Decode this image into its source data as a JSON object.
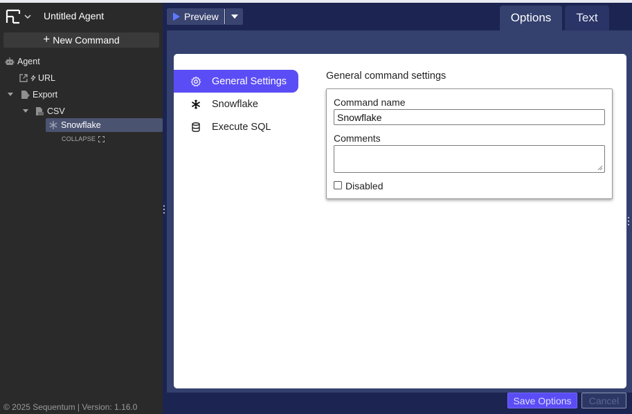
{
  "app": {
    "agent_title": "Untitled Agent",
    "new_command_label": "New Command",
    "footer": "© 2025 Sequentum | Version: 1.16.0"
  },
  "tree": {
    "items": [
      {
        "label": "Agent",
        "icon": "robot-icon"
      },
      {
        "label": "URL",
        "icon": "external-link-icon",
        "sub_icon": "lightning-icon"
      },
      {
        "label": "Export",
        "icon": "export-file-icon"
      },
      {
        "label": "CSV",
        "icon": "csv-file-icon"
      },
      {
        "label": "Snowflake",
        "icon": "snowflake-icon",
        "selected": true
      }
    ],
    "collapse_label": "COLLAPSE"
  },
  "toolbar": {
    "preview_label": "Preview"
  },
  "tabs": [
    {
      "label": "Options",
      "active": true
    },
    {
      "label": "Text",
      "active": false
    }
  ],
  "options_nav": [
    {
      "label": "General Settings",
      "icon": "gear-icon",
      "active": true
    },
    {
      "label": "Snowflake",
      "icon": "snowflake-icon",
      "active": false
    },
    {
      "label": "Execute SQL",
      "icon": "database-icon",
      "active": false
    }
  ],
  "general": {
    "section_title": "General command settings",
    "command_name_label": "Command name",
    "command_name_value": "Snowflake",
    "comments_label": "Comments",
    "comments_value": "",
    "disabled_label": "Disabled",
    "disabled_checked": false
  },
  "actions": {
    "save_label": "Save Options",
    "cancel_label": "Cancel"
  },
  "colors": {
    "accent": "#5b4df5",
    "header_bg": "#1c2451",
    "panel_bg": "#2a2a2a"
  }
}
